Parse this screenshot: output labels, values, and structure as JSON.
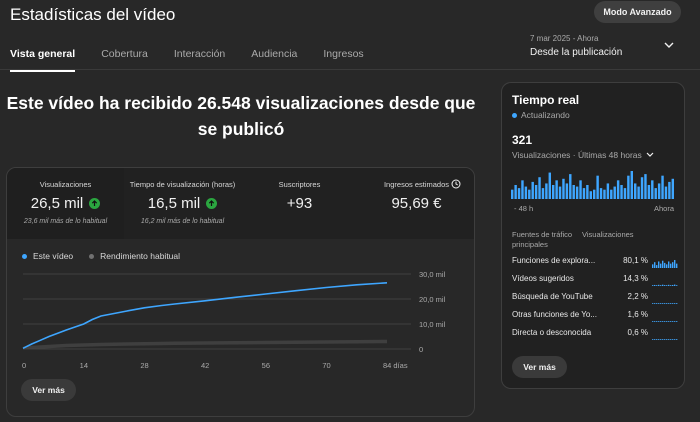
{
  "header": {
    "title": "Estadísticas del vídeo",
    "advanced_button": "Modo Avanzado",
    "date_range_sub": "7 mar 2025 - Ahora",
    "date_range_main": "Desde la publicación"
  },
  "tabs": [
    {
      "label": "Vista general",
      "active": true
    },
    {
      "label": "Cobertura",
      "active": false
    },
    {
      "label": "Interacción",
      "active": false
    },
    {
      "label": "Audiencia",
      "active": false
    },
    {
      "label": "Ingresos",
      "active": false
    }
  ],
  "headline": "Este vídeo ha recibido 26.548 visualizaciones desde que se publicó",
  "metrics": [
    {
      "label": "Visualizaciones",
      "value": "26,5 mil",
      "compare": "23,6 mil más de lo habitual",
      "up": true
    },
    {
      "label": "Tiempo de visualización (horas)",
      "value": "16,5 mil",
      "compare": "16,2 mil más de lo habitual",
      "up": true
    },
    {
      "label": "Suscriptores",
      "value": "+93",
      "compare": "",
      "up": false
    },
    {
      "label": "Ingresos estimados",
      "value": "95,69 €",
      "compare": "",
      "up": false
    }
  ],
  "legend": {
    "this_video": "Este vídeo",
    "typical": "Rendimiento habitual"
  },
  "chart_data": {
    "type": "line",
    "x": [
      0,
      2,
      4,
      6,
      8,
      10,
      12,
      14,
      16,
      18,
      21,
      24,
      28,
      32,
      35,
      42,
      49,
      56,
      63,
      70,
      77,
      84
    ],
    "series": [
      {
        "name": "Este vídeo",
        "values": [
          0.3,
          2.0,
          3.5,
          5.0,
          6.3,
          7.6,
          8.8,
          10.0,
          11.8,
          13.2,
          14.2,
          15.2,
          16.5,
          17.4,
          18.0,
          19.3,
          20.7,
          22.0,
          23.3,
          24.6,
          25.7,
          26.5
        ]
      },
      {
        "name": "Rendimiento habitual",
        "values": [
          0.4,
          0.8,
          1.0,
          1.2,
          1.4,
          1.6,
          1.7,
          1.8,
          1.9,
          2.0,
          2.1,
          2.2,
          2.3,
          2.4,
          2.5,
          2.6,
          2.7,
          2.8,
          2.9,
          3.0,
          3.1,
          3.2
        ]
      }
    ],
    "x_ticks": [
      "0",
      "14",
      "28",
      "42",
      "56",
      "70",
      "84 días"
    ],
    "y_ticks": [
      "0",
      "10,0 mil",
      "20,0 mil",
      "30,0 mil"
    ],
    "ylim": [
      0,
      30
    ],
    "xlim": [
      0,
      84
    ],
    "colors": {
      "this_video": "#3ea6ff",
      "typical": "#717171"
    }
  },
  "see_more": "Ver más",
  "realtime": {
    "title": "Tiempo real",
    "status": "Actualizando",
    "count": "321",
    "period": "Visualizaciones · Últimas 48 horas",
    "axis_start": "- 48 h",
    "axis_end": "Ahora",
    "bars": [
      6,
      9,
      7,
      12,
      8,
      6,
      11,
      9,
      14,
      7,
      10,
      17,
      9,
      12,
      8,
      13,
      10,
      16,
      9,
      8,
      12,
      7,
      9,
      5,
      6,
      15,
      7,
      6,
      10,
      6,
      8,
      12,
      9,
      7,
      15,
      18,
      10,
      8,
      14,
      16,
      9,
      12,
      7,
      10,
      15,
      8,
      11,
      13
    ],
    "sources_header_1": "Fuentes de tráfico principales",
    "sources_header_2": "Visualizaciones",
    "sources": [
      {
        "name": "Funciones de explora...",
        "pct": "80,1 %",
        "level": 0.801
      },
      {
        "name": "Vídeos sugeridos",
        "pct": "14,3 %",
        "level": 0.143
      },
      {
        "name": "Búsqueda de YouTube",
        "pct": "2,2 %",
        "level": 0.022
      },
      {
        "name": "Otras funciones de Yo...",
        "pct": "1,6 %",
        "level": 0.016
      },
      {
        "name": "Directa o desconocida",
        "pct": "0,6 %",
        "level": 0.006
      }
    ],
    "accent": "#3ea6ff"
  }
}
